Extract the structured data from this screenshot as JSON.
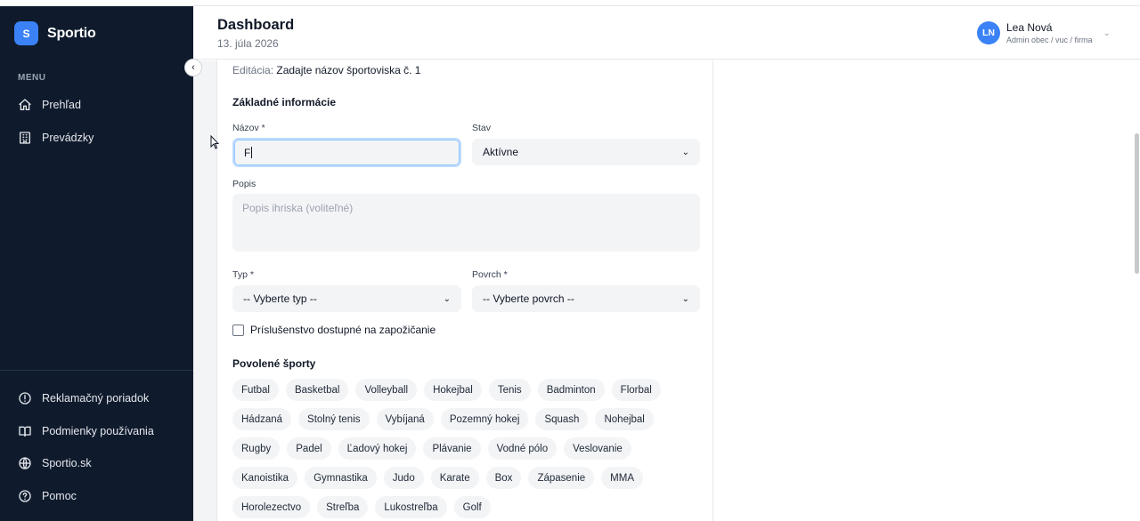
{
  "app": {
    "logo_letter": "S",
    "name": "Sportio"
  },
  "sidebar": {
    "menu_label": "MENU",
    "items": [
      {
        "label": "Prehľad",
        "icon": "home-icon"
      },
      {
        "label": "Prevádzky",
        "icon": "building-icon"
      }
    ],
    "bottom_items": [
      {
        "label": "Reklamačný poriadok",
        "icon": "alert-circle-icon"
      },
      {
        "label": "Podmienky používania",
        "icon": "book-icon"
      },
      {
        "label": "Sportio.sk",
        "icon": "globe-icon"
      },
      {
        "label": "Pomoc",
        "icon": "help-circle-icon"
      }
    ]
  },
  "header": {
    "title": "Dashboard",
    "date": "13. júla 2026",
    "user": {
      "initials": "LN",
      "name": "Lea Nová",
      "role": "Admin obec / vuc / firma"
    }
  },
  "form": {
    "edit_prefix": "Editácia:",
    "edit_title": "Zadajte názov športoviska č. 1",
    "section_basic": "Základné informácie",
    "name_label": "Názov *",
    "name_value": "F",
    "status_label": "Stav",
    "status_value": "Aktívne",
    "description_label": "Popis",
    "description_placeholder": "Popis ihriska (voliteľné)",
    "type_label": "Typ *",
    "type_value": "-- Vyberte typ --",
    "surface_label": "Povrch *",
    "surface_value": "-- Vyberte povrch --",
    "accessories_label": "Príslušenstvo dostupné na zapožičanie",
    "accessories_checked": false,
    "sports_title": "Povolené športy",
    "sports_rows": [
      [
        "Futbal",
        "Basketbal",
        "Volleyball",
        "Hokejbal",
        "Tenis",
        "Badminton",
        "Florbal"
      ],
      [
        "Hádzaná",
        "Stolný tenis",
        "Vybíjaná",
        "Pozemný hokej",
        "Squash",
        "Nohejbal"
      ],
      [
        "Rugby",
        "Padel",
        "Ľadový hokej",
        "Plávanie",
        "Vodné pólo",
        "Veslovanie"
      ],
      [
        "Kanoistika",
        "Gymnastika",
        "Judo",
        "Karate",
        "Box",
        "Zápasenie",
        "MMA"
      ],
      [
        "Horolezectvo",
        "Streľba",
        "Lukostreľba",
        "Golf"
      ]
    ]
  },
  "colors": {
    "sidebar_bg": "#0f1b2d",
    "accent": "#3b82f6",
    "field_bg": "#f3f4f6"
  }
}
